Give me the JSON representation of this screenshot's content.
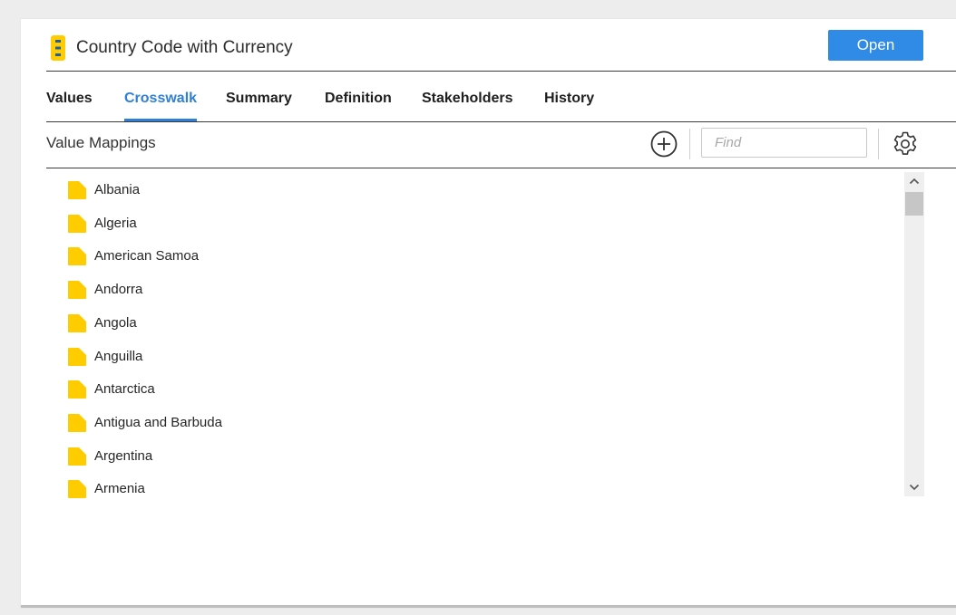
{
  "header": {
    "title": "Country Code with Currency",
    "open_label": "Open"
  },
  "tabs": [
    {
      "label": "Values",
      "active": false
    },
    {
      "label": "Crosswalk",
      "active": true
    },
    {
      "label": "Summary",
      "active": false
    },
    {
      "label": "Definition",
      "active": false
    },
    {
      "label": "Stakeholders",
      "active": false
    },
    {
      "label": "History",
      "active": false
    }
  ],
  "toolbar": {
    "section_title": "Value Mappings",
    "find_placeholder": "Find",
    "find_value": "",
    "add_icon": "plus-circle-icon",
    "settings_icon": "gear-icon"
  },
  "items": [
    {
      "label": "Albania"
    },
    {
      "label": "Algeria"
    },
    {
      "label": "American Samoa"
    },
    {
      "label": "Andorra"
    },
    {
      "label": "Angola"
    },
    {
      "label": "Anguilla"
    },
    {
      "label": "Antarctica"
    },
    {
      "label": "Antigua and Barbuda"
    },
    {
      "label": "Argentina"
    },
    {
      "label": "Armenia"
    }
  ],
  "colors": {
    "accent": "#2f7fd9",
    "button": "#2f8be6",
    "folder": "#ffcc00"
  }
}
